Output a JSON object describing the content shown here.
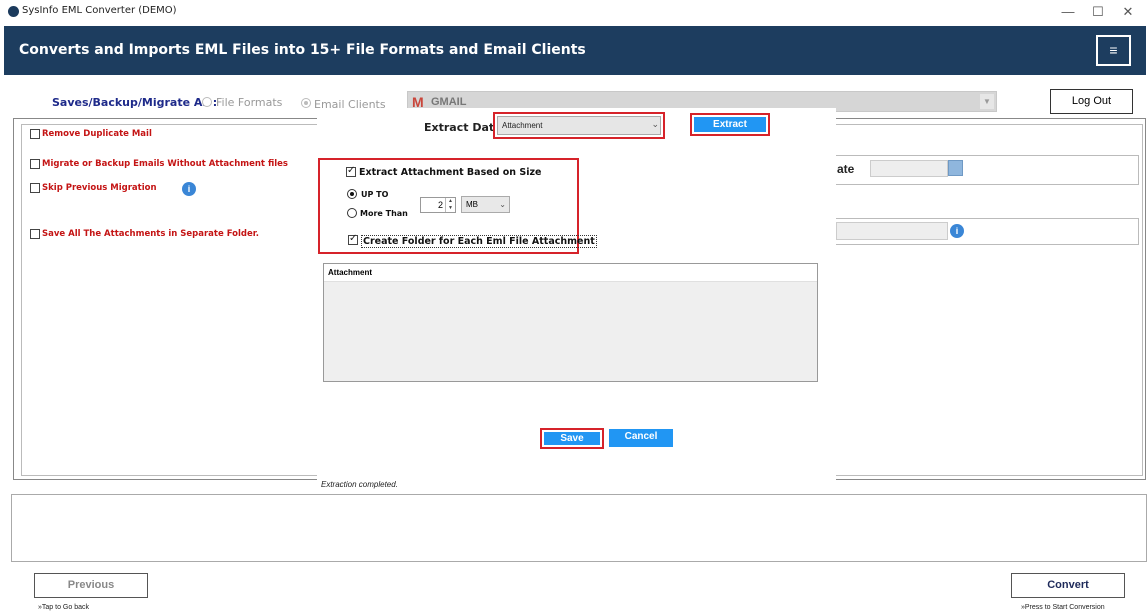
{
  "window": {
    "title": "SysInfo EML Converter (DEMO)",
    "minimize": "—",
    "maximize": "☐",
    "close": "✕"
  },
  "header": {
    "title": "Converts and Imports EML Files into 15+ File Formats and Email Clients",
    "menu_icon": "≡"
  },
  "saves": {
    "label": "Saves/Backup/Migrate As :",
    "option_file_formats": "File Formats",
    "option_email_clients": "Email Clients",
    "selected_client": "GMAIL",
    "logout": "Log Out"
  },
  "options": {
    "remove_duplicate": "Remove Duplicate Mail",
    "without_attachment": "Migrate or Backup Emails Without Attachment files",
    "skip_previous": "Skip Previous Migration",
    "save_attachments_separate": "Save All The Attachments in Separate Folder.",
    "date_label": "ate"
  },
  "dialog": {
    "extract_data_label": "Extract Data",
    "extract_data_value": "Attachment",
    "extract_button": "Extract",
    "based_on_size_label": "Extract Attachment Based on Size",
    "based_on_size_checked": true,
    "up_to_label": "UP TO",
    "more_than_label": "More Than",
    "size_value": "2",
    "unit_value": "MB",
    "create_folder_label": "Create Folder for Each Eml File Attachment",
    "create_folder_checked": true,
    "attachment_header": "Attachment",
    "save_button": "Save",
    "cancel_button": "Cancel",
    "status": "Extraction completed."
  },
  "footer": {
    "previous_button": "Previous",
    "previous_hint": "»Tap to Go back",
    "convert_button": "Convert",
    "convert_hint": "»Press to Start Conversion"
  },
  "colors": {
    "header_bg": "#1d3d5f",
    "accent_blue": "#2196f3",
    "highlight_red": "#d6232a",
    "option_red": "#c41414"
  }
}
